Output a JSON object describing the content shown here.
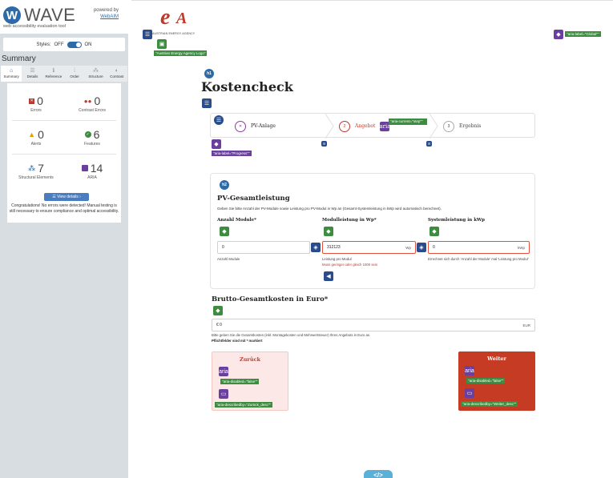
{
  "wave": {
    "logo_letter": "W",
    "logo_text": "WAVE",
    "subtitle": "web accessibility evaluation tool",
    "powered_by": "powered by",
    "webaim_link": "WebAIM",
    "styles_label": "Styles:",
    "styles_off": "OFF",
    "styles_on": "ON",
    "summary_title": "Summary",
    "tabs": [
      {
        "label": "Summary",
        "icon": "home-icon",
        "glyph": "⌂"
      },
      {
        "label": "Details",
        "icon": "list-icon",
        "glyph": "☰"
      },
      {
        "label": "Reference",
        "icon": "info-icon",
        "glyph": "ℹ"
      },
      {
        "label": "Order",
        "icon": "order-icon",
        "glyph": "⁞"
      },
      {
        "label": "Structure",
        "icon": "structure-icon",
        "glyph": "⁂"
      },
      {
        "label": "Contrast",
        "icon": "contrast-icon",
        "glyph": "◐"
      }
    ],
    "stats": {
      "errors": {
        "value": "0",
        "label": "Errors"
      },
      "contrast_errors": {
        "value": "0",
        "label": "Contrast Errors"
      },
      "alerts": {
        "value": "0",
        "label": "Alerts"
      },
      "features": {
        "value": "6",
        "label": "Features"
      },
      "structural": {
        "value": "7",
        "label": "Structural Elements"
      },
      "aria": {
        "value": "14",
        "label": "ARIA"
      }
    },
    "view_details": "☰ View details ›",
    "congrats": "Congratulations! No errors were detected! Manual testing is still necessary to ensure compliance and optimal accessibility."
  },
  "page": {
    "logo_name": "AUSTRIAN ENERGY AGENCY",
    "logo_alt_label": "\"Austrian Energy Agency Logo\"",
    "global_label": "\"aria-label=\"Global\"\"",
    "h1_badge": "h1",
    "h2_badge": "h2",
    "title": "Kostencheck",
    "progress_label": "\"aria-label=\"Progress\"\"",
    "aria_current_label": "\"aria-current=\"step\"\"",
    "steps": [
      {
        "num": "1",
        "label": "PV-Anlage",
        "state": "done"
      },
      {
        "num": "2",
        "label": "Angebot",
        "state": "active"
      },
      {
        "num": "3",
        "label": "Ergebnis",
        "state": "todo"
      }
    ],
    "section_title": "PV-Gesamtleistung",
    "section_desc": "Geben Sie bitte Anzahl der PV-Module sowie Leistung pro PV-Modul in Wp an (Gesamt-Systemleistung in kWp wird automatisch berechnet).",
    "fields": {
      "modules": {
        "label": "Anzahl Module*",
        "value": "0",
        "help": "Anzahl Module"
      },
      "power": {
        "label": "Modulleistung in Wp*",
        "value": "312123",
        "unit": "Wp",
        "help": "Leistung pro Modul",
        "error": "Muss geringer oder gleich 1000 sein"
      },
      "system": {
        "label": "Systemleistung in kWp",
        "value": "0",
        "unit": "kWp",
        "help": "Errechnet sich durch 'Anzahl der Module' mal 'Leistung pro Modul'"
      }
    },
    "brutto_title": "Brutto-Gesamtkosten in Euro*",
    "brutto_value": "€ 0",
    "brutto_unit": "EUR",
    "brutto_help": "Bitte geben Sie die Gesamtkosten (inkl. Montagekosten und Mehrwertsteuer) Ihres Angebots in Euro an.",
    "required_note": "Pflichtfelder sind mit * markiert",
    "back_label": "Zurück",
    "next_label": "Weiter",
    "aria_disabled_label": "\"aria-disabled=\"false\"\"",
    "back_describedby": "\"aria-describedby=\"Zurück_desc\"\"",
    "next_describedby": "\"aria-describedby=\"Weiter_desc\"\"",
    "code_toggle": "</>"
  }
}
